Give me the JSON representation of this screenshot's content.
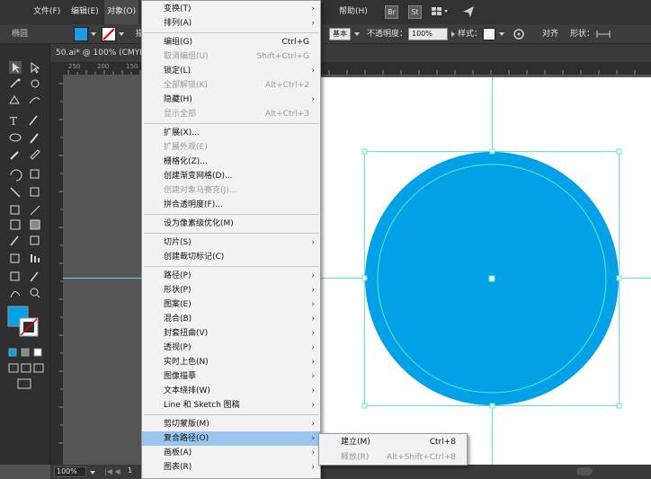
{
  "menubar": {
    "items": [
      "文件(F)",
      "编辑(E)",
      "对象(O)",
      "帮助(H)"
    ],
    "icons": [
      "bridge-icon",
      "stock-icon",
      "workspace-icon",
      "send-icon"
    ],
    "icon_labels": {
      "bridge": "Br",
      "stock": "St"
    }
  },
  "controlbar": {
    "group_label": "椭圆",
    "fill_color": "#1a9ee6",
    "stroke_style_label": "基本",
    "opacity_label": "不透明度：",
    "opacity_value": "100%",
    "style_label": "样式：",
    "align_label": "对齐",
    "shape_label": "形状："
  },
  "document": {
    "tab_title": "50.ai* @ 100% (CMYK",
    "ruler_labels": [
      "250",
      "200",
      "150"
    ]
  },
  "statusbar": {
    "zoom": "100%",
    "page": "1"
  },
  "object_menu": {
    "items": [
      {
        "label": "变换(T)",
        "submenu": true
      },
      {
        "label": "排列(A)",
        "submenu": true
      },
      {
        "sep": true
      },
      {
        "label": "编组(G)",
        "shortcut": "Ctrl+G"
      },
      {
        "label": "取消编组(U)",
        "shortcut": "Shift+Ctrl+G",
        "disabled": true
      },
      {
        "label": "锁定(L)",
        "submenu": true
      },
      {
        "label": "全部解锁(K)",
        "shortcut": "Alt+Ctrl+2",
        "disabled": true
      },
      {
        "label": "隐藏(H)",
        "submenu": true
      },
      {
        "label": "显示全部",
        "shortcut": "Alt+Ctrl+3",
        "disabled": true
      },
      {
        "sep": true
      },
      {
        "label": "扩展(X)..."
      },
      {
        "label": "扩展外观(E)",
        "disabled": true
      },
      {
        "label": "栅格化(Z)..."
      },
      {
        "label": "创建渐变网格(D)..."
      },
      {
        "label": "创建对象马赛克(J)...",
        "disabled": true
      },
      {
        "label": "拼合透明度(F)..."
      },
      {
        "sep": true
      },
      {
        "label": "设为像素级优化(M)"
      },
      {
        "sep": true
      },
      {
        "label": "切片(S)",
        "submenu": true
      },
      {
        "label": "创建裁切标记(C)"
      },
      {
        "sep": true
      },
      {
        "label": "路径(P)",
        "submenu": true
      },
      {
        "label": "形状(P)",
        "submenu": true
      },
      {
        "label": "图案(E)",
        "submenu": true
      },
      {
        "label": "混合(B)",
        "submenu": true
      },
      {
        "label": "封套扭曲(V)",
        "submenu": true
      },
      {
        "label": "透视(P)",
        "submenu": true
      },
      {
        "label": "实时上色(N)",
        "submenu": true
      },
      {
        "label": "图像描摹",
        "submenu": true
      },
      {
        "label": "文本绕排(W)",
        "submenu": true
      },
      {
        "label": "Line 和 Sketch 图稿",
        "submenu": true
      },
      {
        "sep": true
      },
      {
        "label": "剪切蒙版(M)",
        "submenu": true
      },
      {
        "label": "复合路径(O)",
        "submenu": true,
        "highlighted": true
      },
      {
        "label": "画板(A)",
        "submenu": true
      },
      {
        "label": "图表(R)",
        "submenu": true
      }
    ]
  },
  "compound_path_submenu": {
    "items": [
      {
        "label": "建立(M)",
        "shortcut": "Ctrl+8"
      },
      {
        "label": "释放(R)",
        "shortcut": "Alt+Shift+Ctrl+8",
        "disabled": true
      }
    ]
  },
  "colors": {
    "circle_fill": "#00a1e6",
    "guide": "#5fe8c8",
    "menu_highlight": "#9ac6ee"
  }
}
